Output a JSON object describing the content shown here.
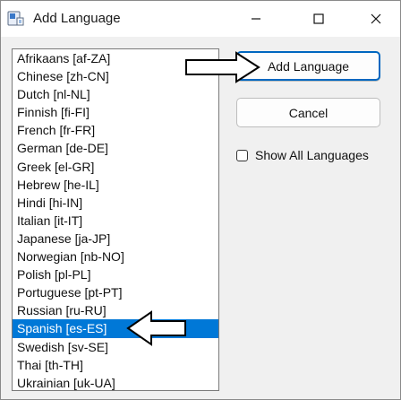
{
  "window": {
    "title": "Add Language",
    "controls": [
      "minimize",
      "maximize",
      "close"
    ]
  },
  "languages": {
    "items": [
      "Afrikaans [af-ZA]",
      "Chinese [zh-CN]",
      "Dutch [nl-NL]",
      "Finnish [fi-FI]",
      "French [fr-FR]",
      "German [de-DE]",
      "Greek [el-GR]",
      "Hebrew [he-IL]",
      "Hindi [hi-IN]",
      "Italian [it-IT]",
      "Japanese [ja-JP]",
      "Norwegian [nb-NO]",
      "Polish [pl-PL]",
      "Portuguese [pt-PT]",
      "Russian [ru-RU]",
      "Spanish [es-ES]",
      "Swedish [sv-SE]",
      "Thai [th-TH]",
      "Ukrainian [uk-UA]"
    ],
    "selected": "Spanish [es-ES]"
  },
  "buttons": {
    "add_label": "Add Language",
    "cancel_label": "Cancel"
  },
  "options": {
    "show_all_label": "Show All Languages",
    "show_all_checked": false
  },
  "colors": {
    "selection": "#0078d7",
    "default_button_border": "#0067c0"
  },
  "icons": [
    "app-icon",
    "minimize-icon",
    "maximize-icon",
    "close-icon",
    "right-arrow-icon",
    "left-arrow-icon"
  ]
}
